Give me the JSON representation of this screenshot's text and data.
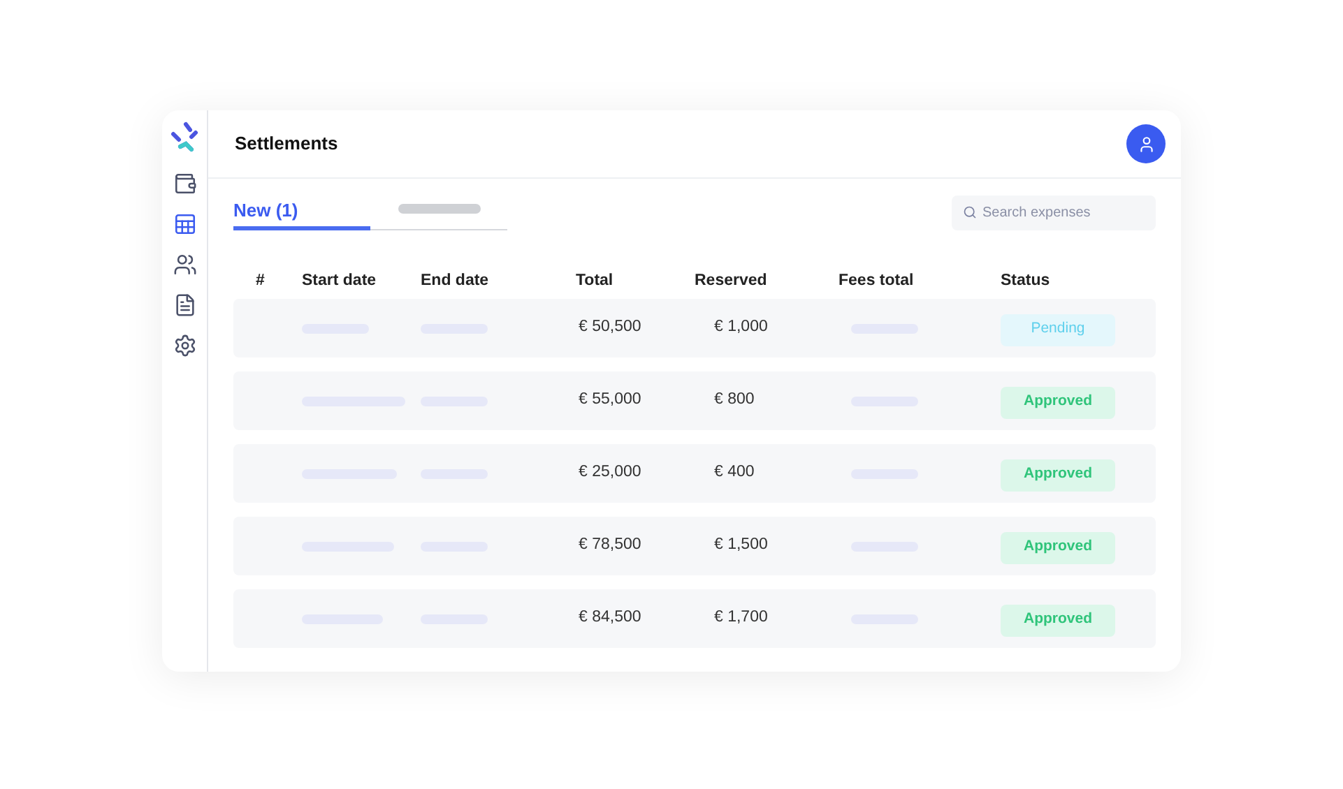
{
  "sidebar": {
    "items": [
      {
        "kind": "money",
        "selected": false
      },
      {
        "kind": "table",
        "selected": true
      },
      {
        "kind": "users",
        "selected": false
      },
      {
        "kind": "doc",
        "selected": false
      },
      {
        "kind": "settings",
        "selected": false
      }
    ]
  },
  "header": {
    "title": "Settlements"
  },
  "tabs": [
    {
      "label": "New (1)",
      "selected": true
    },
    {
      "selected": false
    }
  ],
  "search": {
    "placeholder": "Search expenses"
  },
  "table": {
    "columns": [
      "#",
      "Start date",
      "End date",
      "Total",
      "Reserved",
      "Fees total",
      "Status"
    ],
    "rows": [
      {
        "total": "€ 50,500",
        "reserved": "€ 1,000",
        "status": "Pending",
        "kind": "pending"
      },
      {
        "total": "€ 55,000",
        "reserved": "€ 800",
        "status": "Approved",
        "kind": "approved"
      },
      {
        "total": "€ 25,000",
        "reserved": "€ 400",
        "status": "Approved",
        "kind": "approved"
      },
      {
        "total": "€ 78,500",
        "reserved": "€ 1,500",
        "status": "Approved",
        "kind": "approved"
      },
      {
        "total": "€ 84,500",
        "reserved": "€ 1,700",
        "status": "Approved",
        "kind": "approved"
      }
    ]
  }
}
